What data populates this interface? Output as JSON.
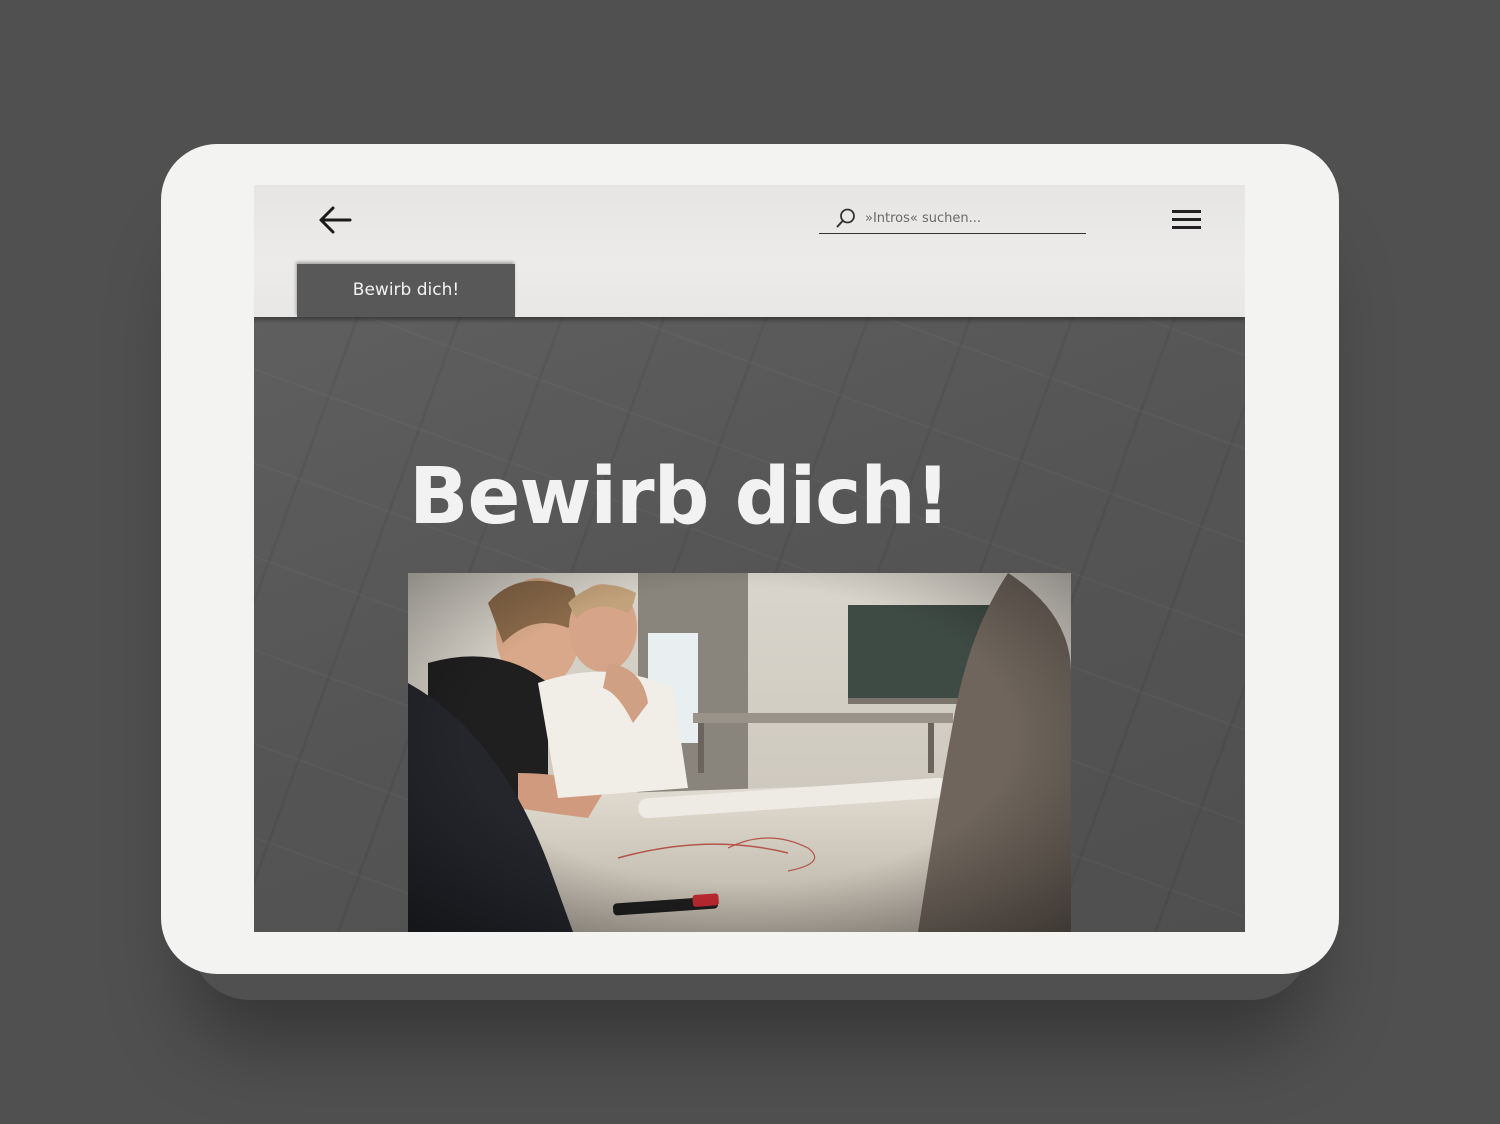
{
  "header": {
    "search": {
      "placeholder": "»Intros« suchen..."
    },
    "icons": {
      "back": "arrow-left-icon",
      "search": "search-icon",
      "menu": "hamburger-menu-icon"
    }
  },
  "tab": {
    "label": "Bewirb dich!"
  },
  "main": {
    "title": "Bewirb dich!"
  },
  "colors": {
    "background": "#505050",
    "device_frame": "#f3f3f2",
    "header_bg": "#e8e7e5",
    "content_bg": "#575757",
    "tab_bg": "#585858",
    "title_text": "#f2f2f2"
  }
}
